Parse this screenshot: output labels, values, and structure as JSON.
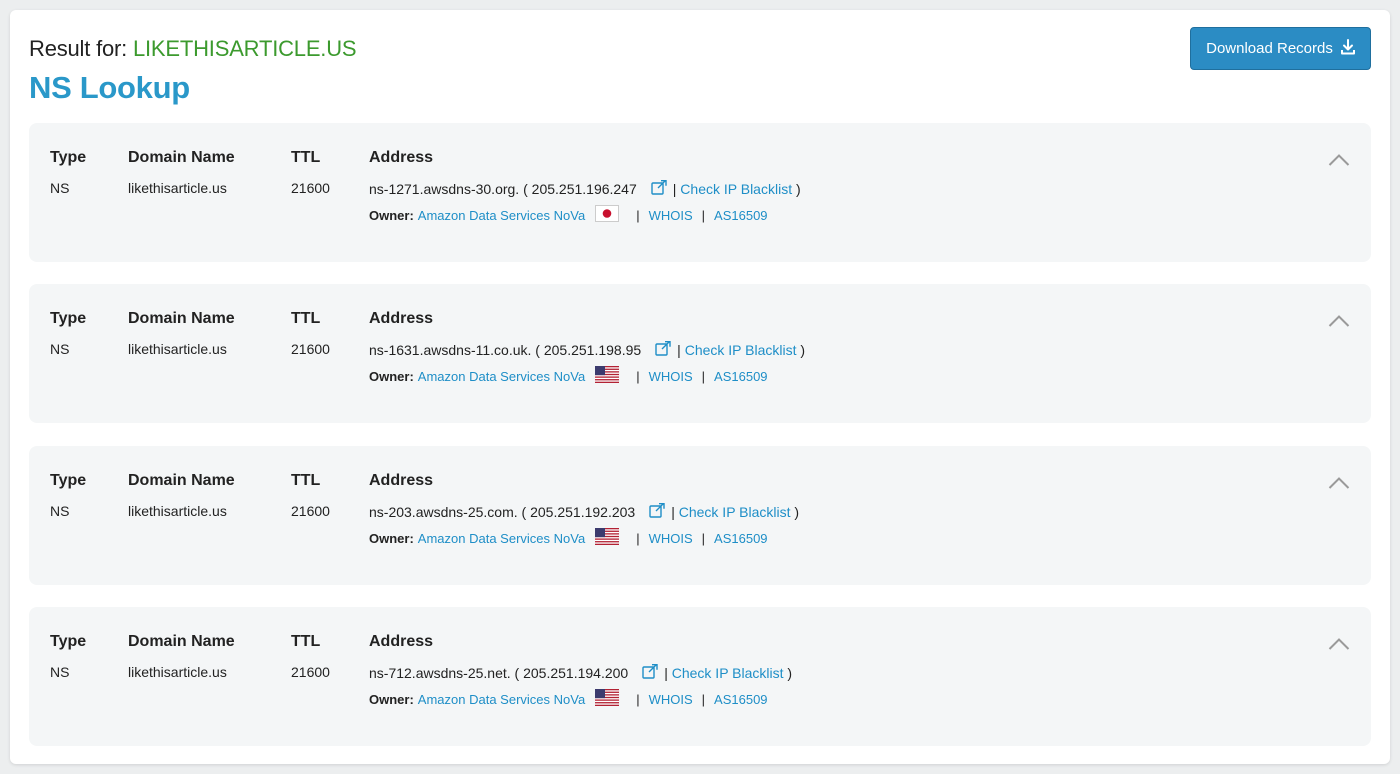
{
  "header": {
    "result_label": "Result for:",
    "domain": "LIKETHISARTICLE.US",
    "title": "NS Lookup",
    "download_label": "Download Records"
  },
  "columns": {
    "type": "Type",
    "domain": "Domain Name",
    "ttl": "TTL",
    "address": "Address"
  },
  "owner_label": "Owner:",
  "whois_label": "WHOIS",
  "blacklist_label": "Check IP Blacklist",
  "records": [
    {
      "type": "NS",
      "domain": "likethisarticle.us",
      "ttl": "21600",
      "host": "ns-1271.awsdns-30.org.",
      "ip": "205.251.196.247",
      "owner": "Amazon Data Services NoVa",
      "flag": "jp-flag",
      "asn": "AS16509"
    },
    {
      "type": "NS",
      "domain": "likethisarticle.us",
      "ttl": "21600",
      "host": "ns-1631.awsdns-11.co.uk.",
      "ip": "205.251.198.95",
      "owner": "Amazon Data Services NoVa",
      "flag": "us-flag",
      "asn": "AS16509"
    },
    {
      "type": "NS",
      "domain": "likethisarticle.us",
      "ttl": "21600",
      "host": "ns-203.awsdns-25.com.",
      "ip": "205.251.192.203",
      "owner": "Amazon Data Services NoVa",
      "flag": "us-flag",
      "asn": "AS16509"
    },
    {
      "type": "NS",
      "domain": "likethisarticle.us",
      "ttl": "21600",
      "host": "ns-712.awsdns-25.net.",
      "ip": "205.251.194.200",
      "owner": "Amazon Data Services NoVa",
      "flag": "us-flag",
      "asn": "AS16509"
    }
  ],
  "colors": {
    "accent": "#2a98c9",
    "link": "#1e8ec7",
    "domain_green": "#3c9a2e",
    "button": "#2b8cc4"
  }
}
